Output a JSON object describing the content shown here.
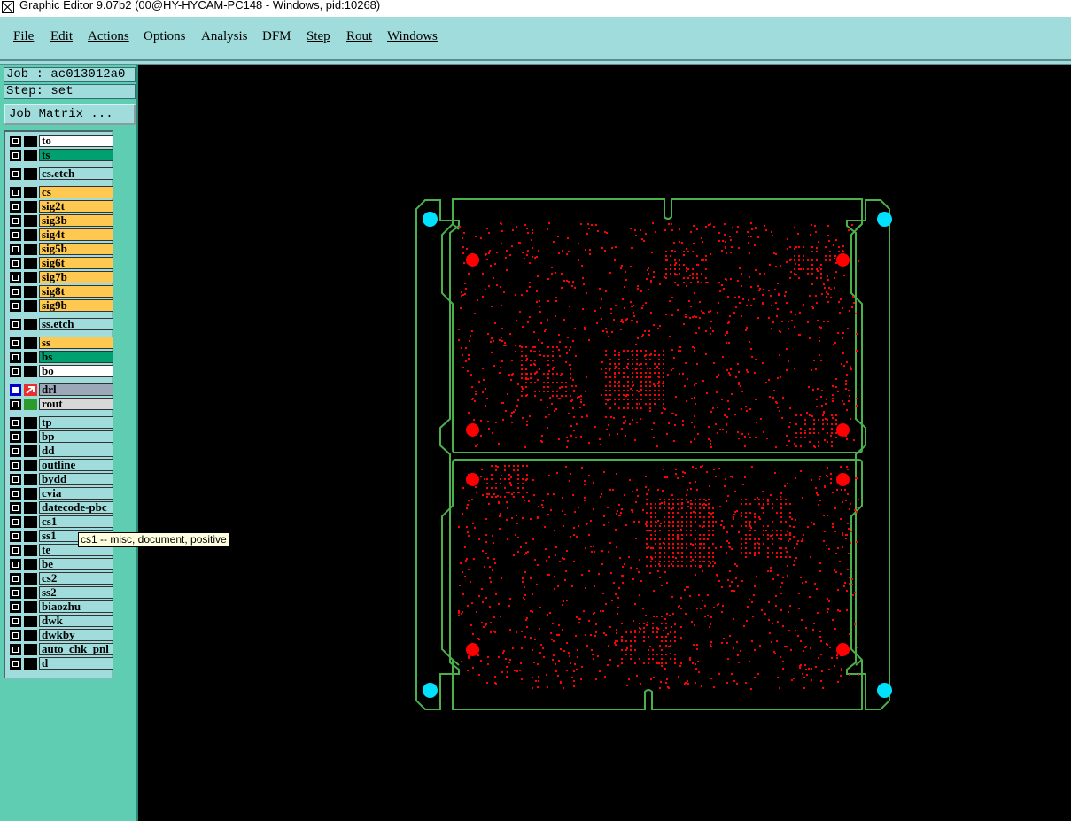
{
  "window": {
    "title": "Graphic Editor 9.07b2 (00@HY-HYCAM-PC148 - Windows, pid:10268)"
  },
  "menu": {
    "items": [
      "File",
      "Edit",
      "Actions",
      "Options",
      "Analysis",
      "DFM",
      "Step",
      "Rout",
      "Windows"
    ]
  },
  "job": {
    "label": "Job : ac013012a0",
    "step": "Step: set",
    "matrix_button": "Job Matrix ..."
  },
  "layers": [
    {
      "name": "to",
      "color": "#ffffff"
    },
    {
      "name": "ts",
      "color": "#00a070"
    },
    {
      "name": "cs.etch",
      "color": "#a0dcdc"
    },
    {
      "name": "cs",
      "color": "#ffc850"
    },
    {
      "name": "sig2t",
      "color": "#ffc850"
    },
    {
      "name": "sig3b",
      "color": "#ffc850"
    },
    {
      "name": "sig4t",
      "color": "#ffc850"
    },
    {
      "name": "sig5b",
      "color": "#ffc850"
    },
    {
      "name": "sig6t",
      "color": "#ffc850"
    },
    {
      "name": "sig7b",
      "color": "#ffc850"
    },
    {
      "name": "sig8t",
      "color": "#ffc850"
    },
    {
      "name": "sig9b",
      "color": "#ffc850"
    },
    {
      "name": "ss.etch",
      "color": "#a0dcdc"
    },
    {
      "name": "ss",
      "color": "#ffc850"
    },
    {
      "name": "bs",
      "color": "#00a070"
    },
    {
      "name": "bo",
      "color": "#ffffff"
    },
    {
      "name": "drl",
      "color": "#9aa8b8",
      "active": true
    },
    {
      "name": "rout",
      "color": "#d8d8d8"
    },
    {
      "name": "tp",
      "color": "#a0dcdc"
    },
    {
      "name": "bp",
      "color": "#a0dcdc"
    },
    {
      "name": "dd",
      "color": "#a0dcdc"
    },
    {
      "name": "outline",
      "color": "#a0dcdc"
    },
    {
      "name": "bydd",
      "color": "#a0dcdc"
    },
    {
      "name": "cvia",
      "color": "#a0dcdc"
    },
    {
      "name": "datecode-pbc",
      "color": "#a0dcdc"
    },
    {
      "name": "cs1",
      "color": "#a0dcdc"
    },
    {
      "name": "ss1",
      "color": "#a0dcdc"
    },
    {
      "name": "te",
      "color": "#a0dcdc"
    },
    {
      "name": "be",
      "color": "#a0dcdc"
    },
    {
      "name": "cs2",
      "color": "#a0dcdc"
    },
    {
      "name": "ss2",
      "color": "#a0dcdc"
    },
    {
      "name": "biaozhu",
      "color": "#a0dcdc"
    },
    {
      "name": "dwk",
      "color": "#a0dcdc"
    },
    {
      "name": "dwkby",
      "color": "#a0dcdc"
    },
    {
      "name": "auto_chk_pnl",
      "color": "#a0dcdc"
    },
    {
      "name": "d",
      "color": "#a0dcdc"
    }
  ],
  "tooltip": {
    "text": "cs1 -- misc, document, positive"
  },
  "colors": {
    "outline": "#4ab04a",
    "drill": "#ff0000",
    "tooling_hole": "#00e0ff",
    "canvas": "#000000"
  }
}
